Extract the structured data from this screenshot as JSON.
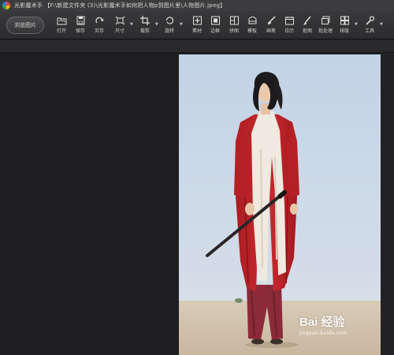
{
  "window": {
    "title": "光影魔术手 【F:\\新建文件夹 (3)\\光影魔术手如何把人物p到图片里\\人物图片.jpeg】",
    "logo_icon": "light-and-shadow-logo-icon"
  },
  "toolbar": {
    "browse_label": "浏览图片",
    "tools": [
      {
        "label": "打开",
        "icon": "open-folder-icon",
        "has_menu": false
      },
      {
        "label": "保存",
        "icon": "save-disk-icon",
        "has_menu": false
      },
      {
        "label": "另存",
        "icon": "save-as-icon",
        "has_menu": false
      },
      {
        "label": "尺寸",
        "icon": "resize-icon",
        "has_menu": true
      },
      {
        "label": "裁剪",
        "icon": "crop-icon",
        "has_menu": true
      },
      {
        "label": "旋转",
        "icon": "rotate-icon",
        "has_menu": true
      },
      {
        "label": "素材",
        "icon": "material-icon",
        "has_menu": false
      },
      {
        "label": "边框",
        "icon": "frame-icon",
        "has_menu": false
      },
      {
        "label": "拼图",
        "icon": "collage-icon",
        "has_menu": false
      },
      {
        "label": "模板",
        "icon": "template-icon",
        "has_menu": false
      },
      {
        "label": "画笔",
        "icon": "brush-icon",
        "has_menu": false
      },
      {
        "label": "日历",
        "icon": "calendar-icon",
        "has_menu": false
      },
      {
        "label": "抠图",
        "icon": "cutout-icon",
        "has_menu": false
      },
      {
        "label": "批处理",
        "icon": "batch-icon",
        "has_menu": false
      },
      {
        "label": "排版",
        "icon": "layout-icon",
        "has_menu": true
      },
      {
        "label": "工具",
        "icon": "tools-icon",
        "has_menu": true
      }
    ]
  },
  "canvas": {
    "image_description_icon": "photo-woman-red-robe",
    "watermark_main": "Bai 经验",
    "watermark_sub": "jingyan.baidu.com"
  },
  "colors": {
    "toolbar_bg": "#2f2f31",
    "workspace_bg": "#1e1e20",
    "sky": "#c9d7e6",
    "robe_red": "#c4262c"
  }
}
